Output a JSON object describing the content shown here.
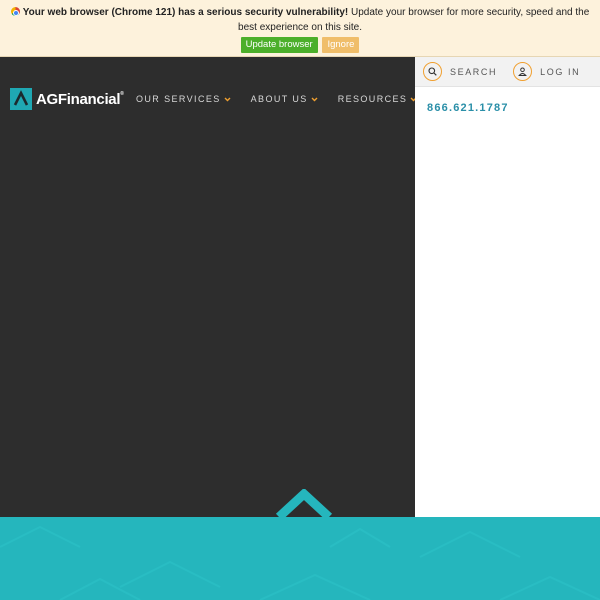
{
  "browser_notice": {
    "icon": "chrome-icon",
    "bold_text": "Your web browser (Chrome 121) has a serious security vulnerability!",
    "text": " Update your browser for more security, speed and the best experience on this site.",
    "update_label": "Update browser",
    "ignore_label": "Ignore",
    "colors": {
      "background": "#fdf2dc",
      "update": "#4caf2a",
      "ignore": "#f0be6a"
    }
  },
  "header": {
    "logo_text": "AGFinancial",
    "logo_reg": "®",
    "nav": [
      {
        "label": "OUR SERVICES"
      },
      {
        "label": "ABOUT US"
      },
      {
        "label": "RESOURCES"
      }
    ]
  },
  "utility": {
    "search_label": "SEARCH",
    "login_label": "LOG IN",
    "phone": "866.621.1787"
  },
  "colors": {
    "dark": "#2d2d2d",
    "accent_orange": "#f0a030",
    "teal": "#25b6bd",
    "phone_blue": "#2a8fa8"
  }
}
